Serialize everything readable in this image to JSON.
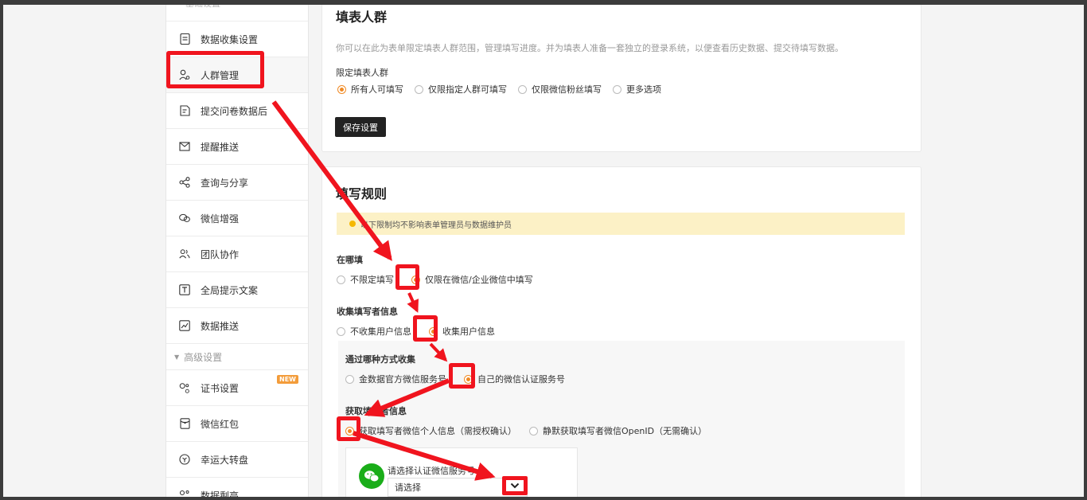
{
  "sidebar": {
    "top_fade": "基础设置",
    "items": [
      {
        "label": "数据收集设置",
        "icon": "document-icon"
      },
      {
        "label": "人群管理",
        "icon": "users-icon"
      },
      {
        "label": "提交问卷数据后",
        "icon": "file-edit-icon"
      },
      {
        "label": "提醒推送",
        "icon": "send-icon"
      },
      {
        "label": "查询与分享",
        "icon": "share-icon"
      },
      {
        "label": "微信增强",
        "icon": "wechat-icon"
      },
      {
        "label": "团队协作",
        "icon": "team-icon"
      },
      {
        "label": "全局提示文案",
        "icon": "text-icon"
      }
    ],
    "item_data_push": {
      "label": "数据推送",
      "icon": "chart-icon"
    },
    "group_advanced": "高级设置",
    "advanced_items": [
      {
        "label": "证书设置",
        "icon": "certificate-icon",
        "badge": "NEW"
      },
      {
        "label": "微信红包",
        "icon": "red-packet-icon"
      },
      {
        "label": "幸运大转盘",
        "icon": "wheel-icon"
      },
      {
        "label": "数据剩亮",
        "icon": "data-icon"
      }
    ]
  },
  "panel_fill_group": {
    "title": "填表人群",
    "description": "你可以在此为表单限定填表人群范围，管理填写进度。并为填表人准备一套独立的登录系统，以便查看历史数据、提交待填写数据。",
    "limit_label": "限定填表人群",
    "options": [
      "所有人可填写",
      "仅限指定人群可填写",
      "仅限微信粉丝填写",
      "更多选项"
    ],
    "selected_index": 0,
    "save_label": "保存设置"
  },
  "panel_rules": {
    "title": "填写规则",
    "notice": "以下限制均不影响表单管理员与数据维护员",
    "where_label": "在哪填",
    "where_options": [
      "不限定填写",
      "仅限在微信/企业微信中填写"
    ],
    "collect_label": "收集填写者信息",
    "collect_options": [
      "不收集用户信息",
      "收集用户信息"
    ],
    "method_label": "通过哪种方式收集",
    "method_options": [
      "金数据官方微信服务号",
      "自己的微信认证服务号"
    ],
    "get_label": "获取填写者信息",
    "get_options": [
      "获取填写者微信个人信息（需授权确认）",
      "静默获取填写者微信OpenID（无需确认）"
    ],
    "wechat_select_label": "请选择认证微信服务号",
    "wechat_select_value": "请选择"
  },
  "colors": {
    "accent": "#f08a24",
    "highlight": "#f0141e",
    "notice_bg": "#fcf1c6",
    "wechat_green": "#1aad19",
    "save_button": "#222222"
  }
}
